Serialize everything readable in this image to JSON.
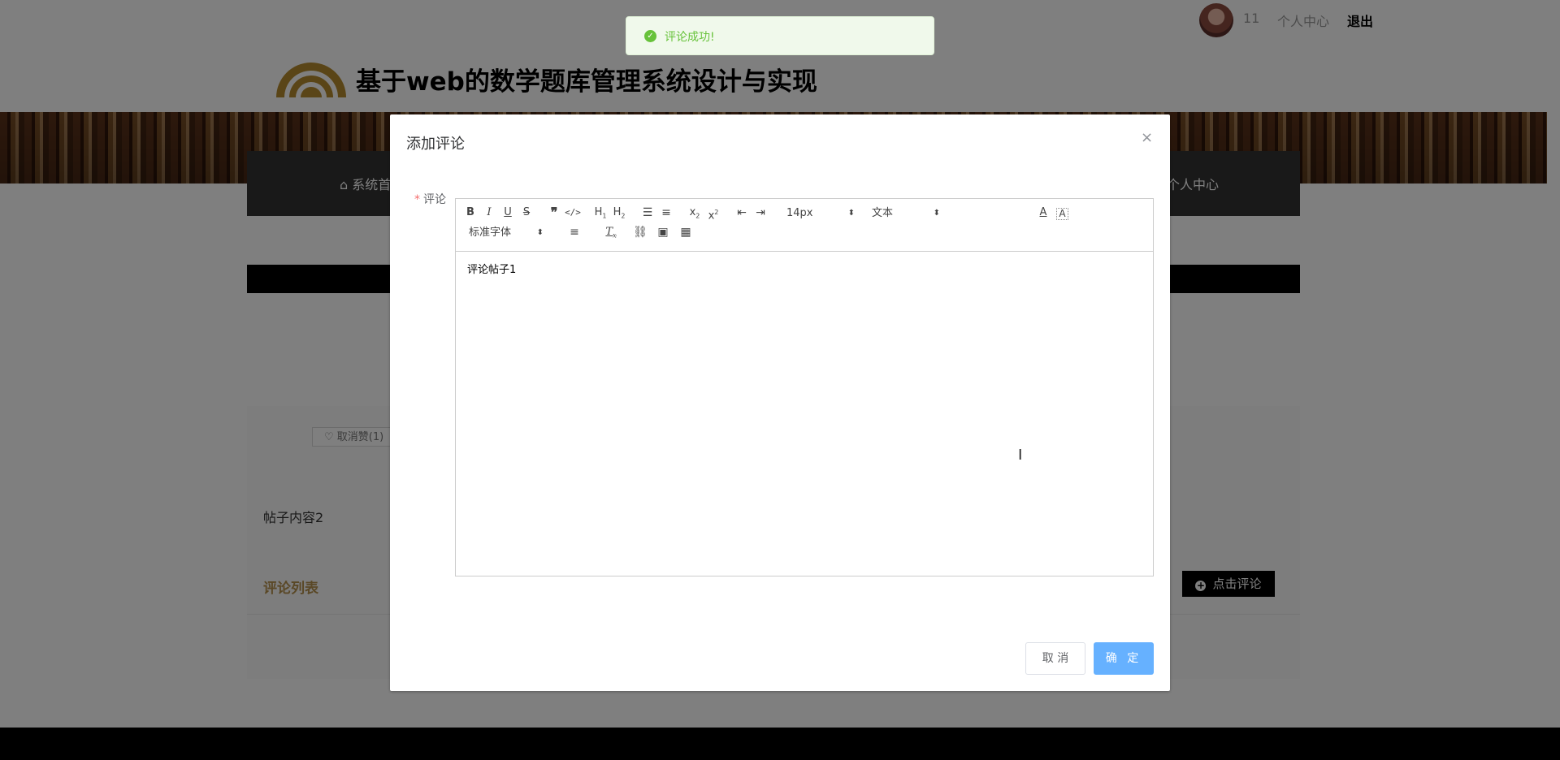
{
  "topbar": {
    "username": "11",
    "center_label": "个人中心",
    "logout_label": "退出"
  },
  "header": {
    "site_title": "基于web的数学题库管理系统设计与实现"
  },
  "nav": {
    "home_label": "⌂ 系统首",
    "me_label": "个人中心"
  },
  "post": {
    "like_label": "♡ 取消赞(1)",
    "content": "帖子内容2",
    "comment_list_title": "评论列表",
    "comment_button_label": "点击评论"
  },
  "toast": {
    "message": "评论成功!"
  },
  "dialog": {
    "title": "添加评论",
    "close_icon": "×",
    "field_label": "评论",
    "required_mark": "*",
    "editor": {
      "font_size_value": "14px",
      "heading_value": "文本",
      "font_family_value": "标准字体",
      "content": "评论帖子1"
    },
    "cancel_label": "取 消",
    "confirm_label": "确 定"
  },
  "colors": {
    "accent": "#66b1ff",
    "success": "#67c23a",
    "nav_bg": "#333333",
    "list_title": "#b5904d"
  }
}
